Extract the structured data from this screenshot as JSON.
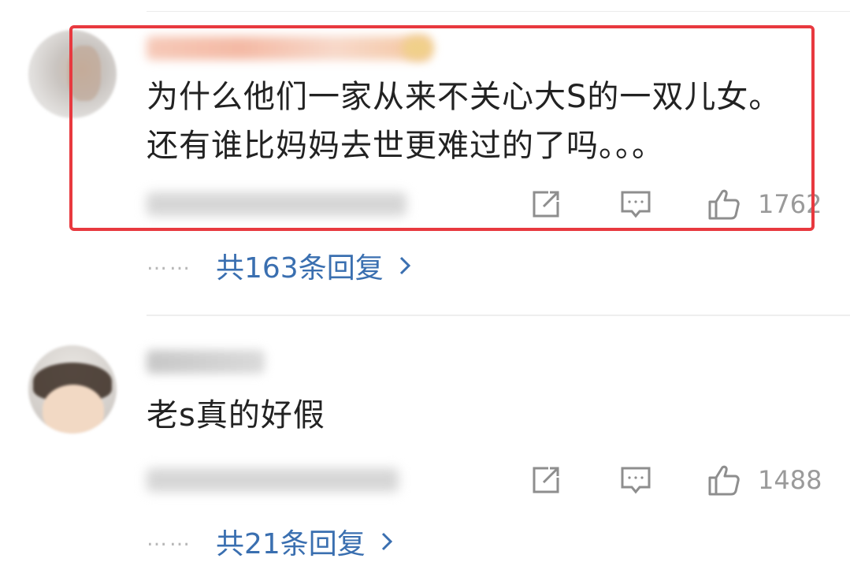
{
  "comments": [
    {
      "text": "为什么他们一家从来不关心大S的一双儿女。还有谁比妈妈去世更难过的了吗。。。",
      "likes": "1762",
      "replies_label": "共163条回复",
      "replies_dots": "……"
    },
    {
      "text": "老s真的好假",
      "likes": "1488",
      "replies_label": "共21条回复",
      "replies_dots": "……"
    }
  ],
  "icons": {
    "share": "share-icon",
    "reply": "comment-icon",
    "like": "thumbs-up-icon",
    "chevron": "chevron-right-icon"
  },
  "colors": {
    "highlight_border": "#e8393f",
    "link": "#3a6fb0",
    "text": "#222222",
    "meta": "#9a9a9a"
  }
}
